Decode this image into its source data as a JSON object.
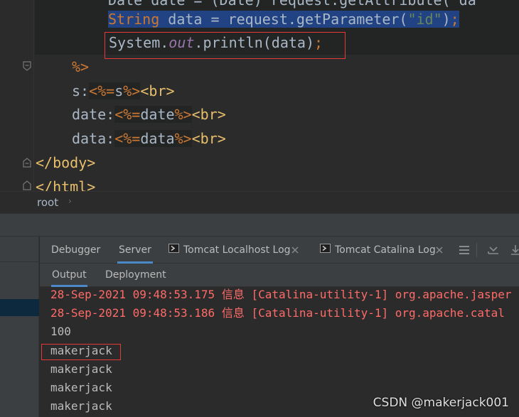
{
  "editor": {
    "line0": {
      "p1": "Date date = (Date) request.getAttribute(\"da"
    },
    "line1": {
      "kw": "String",
      "p1": " data = request.getParameter(",
      "s": "\"id\"",
      "p2": ")",
      "semi": ";"
    },
    "line2": {
      "p1": "System.",
      "fld": "out",
      "p2": ".println(data)",
      "semi": ";"
    },
    "line3": {
      "close": "%>"
    },
    "line4": {
      "lbl": "s:",
      "open": "<%=",
      "var": "s",
      "close": "%>",
      "tag": "<br>"
    },
    "line5": {
      "lbl": "date:",
      "open": "<%=",
      "var": "date",
      "close": "%>",
      "tag": "<br>"
    },
    "line6": {
      "lbl": "data:",
      "open": "<%=",
      "var": "data",
      "close": "%>",
      "tag": "<br>"
    },
    "line7": {
      "tag": "</body>"
    },
    "line8": {
      "tag": "</html>"
    }
  },
  "breadcrumb": {
    "item": "root",
    "sep": "›"
  },
  "tool_window": {
    "tabs": [
      {
        "label": "Debugger"
      },
      {
        "label": "Server"
      },
      {
        "label": "Tomcat Localhost Log"
      },
      {
        "label": "Tomcat Catalina Log"
      }
    ],
    "subtabs": [
      {
        "label": "Output"
      },
      {
        "label": "Deployment"
      }
    ]
  },
  "console": {
    "lines": [
      "28-Sep-2021 09:48:53.175 信息 [Catalina-utility-1] org.apache.jasper",
      "28-Sep-2021 09:48:53.186 信息 [Catalina-utility-1] org.apache.catal",
      "100",
      "makerjack",
      "makerjack",
      "makerjack",
      "makerjack"
    ]
  },
  "watermark": "CSDN @makerjack001",
  "colors": {
    "keyword": "#cc7832",
    "string": "#6a8759",
    "field": "#9876aa",
    "tag": "#e8bf6a",
    "error": "#ff6b68",
    "highlight_box": "#e53935",
    "selection": "#214283"
  }
}
